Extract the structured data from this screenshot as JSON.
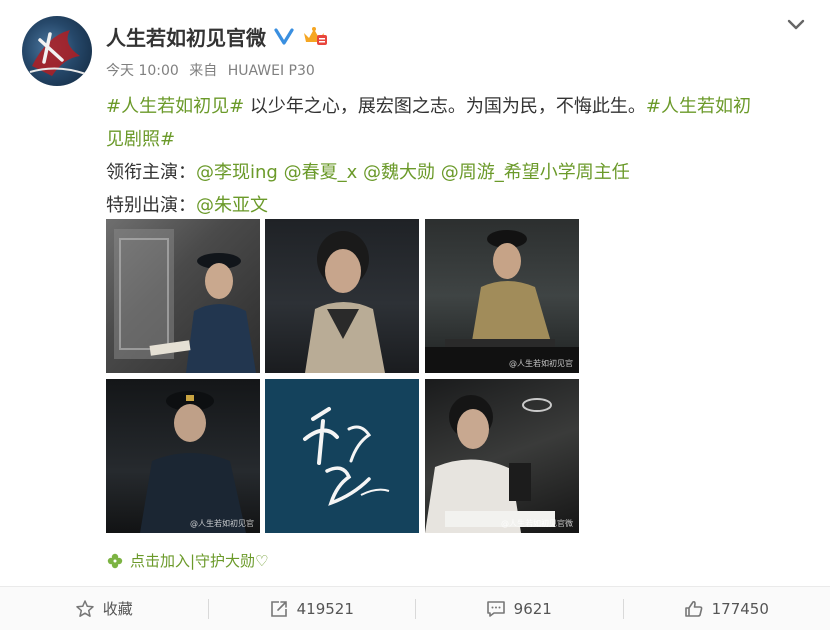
{
  "post": {
    "username": "人生若如初见官微",
    "meta": {
      "time": "今天 10:00",
      "source_prefix": "来自",
      "device": "HUAWEI P30"
    },
    "lines": {
      "tag1": "#人生若如初见#",
      "body": " 以少年之心，展宏图之志。为国为民，不悔此生。",
      "tag2a": "#人生若如初",
      "tag2b": "见剧照#",
      "cast_label": "领衔主演：",
      "cast": [
        "@李现ing",
        "@春夏_x",
        "@魏大勋",
        "@周游_希望小学周主任"
      ],
      "special_label": "特别出演：",
      "special": "@朱亚文"
    },
    "watermarks": [
      "@人生若如初见官",
      "@人生若如初见官",
      "@人生若如初见官微"
    ],
    "follow_link": "点击加入|守护大勋♡",
    "actions": {
      "favorite_label": "收藏",
      "repost_count": "419521",
      "comment_count": "9621",
      "like_count": "177450"
    }
  },
  "colors": {
    "link": "#6b9a2a",
    "verified": "#3a8fe0",
    "text": "#333333"
  },
  "icons": [
    "chevron-down-icon",
    "verified-icon",
    "vip-crown-icon",
    "clover-icon",
    "star-icon",
    "repost-icon",
    "comment-icon",
    "thumbs-up-icon"
  ]
}
